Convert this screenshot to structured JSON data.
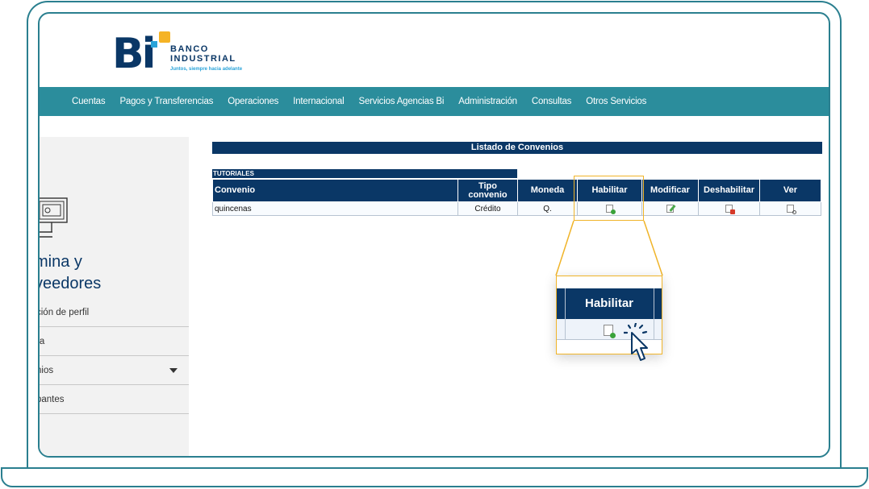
{
  "brand": {
    "line1": "BANCO",
    "line2": "INDUSTRIAL",
    "tagline": "Juntos, siempre hacia adelante",
    "mark": "Bi",
    "colors": {
      "navy": "#0a3766",
      "teal": "#2b8d9c",
      "accent": "#f0b429",
      "frame": "#2a7f8f"
    }
  },
  "nav": {
    "items": [
      "Cuentas",
      "Pagos y Transferencias",
      "Operaciones",
      "Internacional",
      "Servicios Agencias Bi",
      "Administración",
      "Consultas",
      "Otros Servicios"
    ]
  },
  "sidebar": {
    "icon": "monitor-icon",
    "title_line1": "mina y",
    "title_line2": "veedores",
    "items": [
      {
        "label": "ción de perfil"
      },
      {
        "label": "ra"
      },
      {
        "label": "nios",
        "icon": "caret-down-icon"
      },
      {
        "label": "pantes"
      }
    ]
  },
  "main": {
    "title": "Listado de Convenios",
    "section_tag": "TUTORIALES",
    "table": {
      "headers": {
        "convenio": "Convenio",
        "tipo_line1": "Tipo",
        "tipo_line2": "convenio",
        "moneda": "Moneda",
        "habilitar": "Habilitar",
        "modificar": "Modificar",
        "deshabilitar": "Deshabilitar",
        "ver": "Ver"
      },
      "rows": [
        {
          "convenio": "quincenas",
          "tipo": "Crédito",
          "moneda": "Q.",
          "habilitar_icon": "enable-doc-icon",
          "modificar_icon": "edit-doc-icon",
          "deshabilitar_icon": "disable-doc-icon",
          "ver_icon": "view-doc-icon"
        }
      ]
    }
  },
  "zoom": {
    "header": "Habilitar",
    "icon": "enable-doc-icon",
    "pointer": "hand-pointer-icon"
  }
}
